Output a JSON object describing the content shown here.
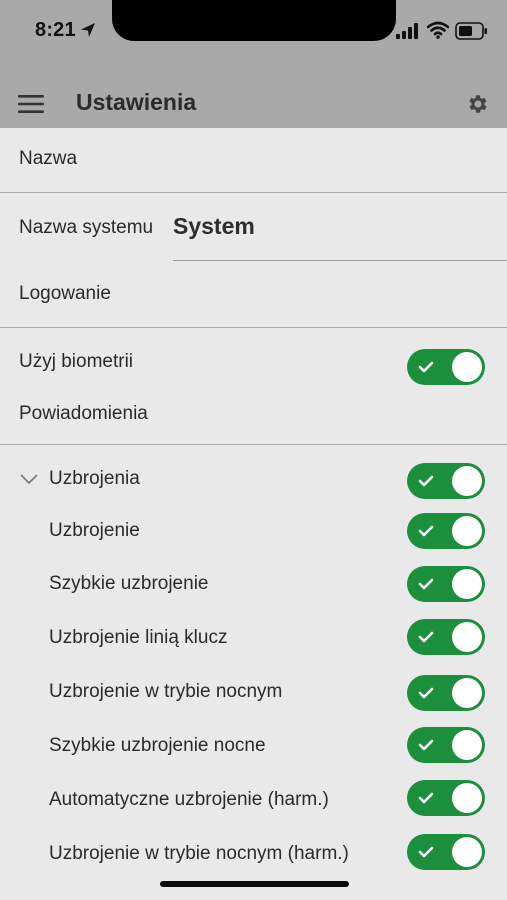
{
  "status_bar": {
    "time": "8:21"
  },
  "header": {
    "title": "Ustawienia"
  },
  "sections": {
    "name": "Nazwa",
    "system_name_label": "Nazwa systemu",
    "system_name_value": "System",
    "login": "Logowanie",
    "biometrics_label": "Użyj biometrii",
    "biometrics_on": true,
    "notifications": "Powiadomienia"
  },
  "arming": {
    "group_label": "Uzbrojenia",
    "group_on": true,
    "items": [
      {
        "label": "Uzbrojenie",
        "on": true
      },
      {
        "label": "Szybkie uzbrojenie",
        "on": true
      },
      {
        "label": "Uzbrojenie linią klucz",
        "on": true
      },
      {
        "label": "Uzbrojenie w trybie nocnym",
        "on": true
      },
      {
        "label": "Szybkie uzbrojenie nocne",
        "on": true
      },
      {
        "label": "Automatyczne uzbrojenie (harm.)",
        "on": true
      },
      {
        "label": "Uzbrojenie w trybie nocnym (harm.)",
        "on": true
      }
    ]
  },
  "colors": {
    "toggle_on": "#1c8f3c",
    "header_bg": "#a9a9a9",
    "page_bg": "#e9e9e9"
  }
}
